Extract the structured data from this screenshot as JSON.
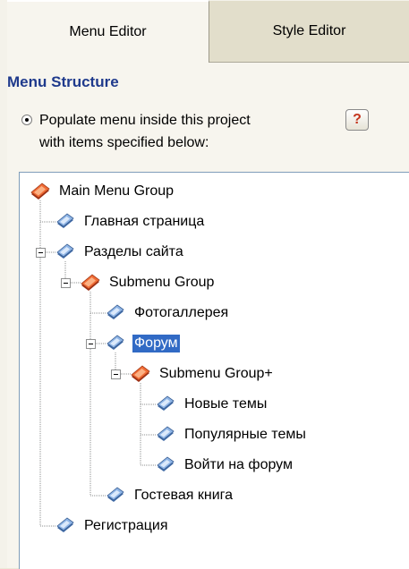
{
  "tabs": [
    {
      "label": "Menu Editor",
      "active": true
    },
    {
      "label": "Style Editor",
      "active": false
    }
  ],
  "section_title": "Menu Structure",
  "option": {
    "line1": "Populate menu inside this project",
    "line2": "with items specified below:",
    "selected": true
  },
  "help_label": "?",
  "colors": {
    "title": "#1f3a8c",
    "selection": "#316ac5",
    "group_icon": "#e85a2a",
    "item_icon": "#6b96cc"
  },
  "tree": [
    {
      "label": "Main Menu Group",
      "kind": "group",
      "depth": 0
    },
    {
      "label": "Главная страница",
      "kind": "item",
      "depth": 1
    },
    {
      "label": "Разделы сайта",
      "kind": "item",
      "depth": 1,
      "expanded": true
    },
    {
      "label": "Submenu Group",
      "kind": "group",
      "depth": 2,
      "expanded": true
    },
    {
      "label": "Фотогаллерея",
      "kind": "item",
      "depth": 3
    },
    {
      "label": "Форум",
      "kind": "item",
      "depth": 3,
      "expanded": true,
      "selected": true
    },
    {
      "label": "Submenu Group+",
      "kind": "group",
      "depth": 4,
      "expanded": true
    },
    {
      "label": "Новые темы",
      "kind": "item",
      "depth": 5
    },
    {
      "label": "Популярные темы",
      "kind": "item",
      "depth": 5
    },
    {
      "label": "Войти на форум",
      "kind": "item",
      "depth": 5
    },
    {
      "label": "Гостевая книга",
      "kind": "item",
      "depth": 3
    },
    {
      "label": "Регистрация",
      "kind": "item",
      "depth": 1
    }
  ]
}
